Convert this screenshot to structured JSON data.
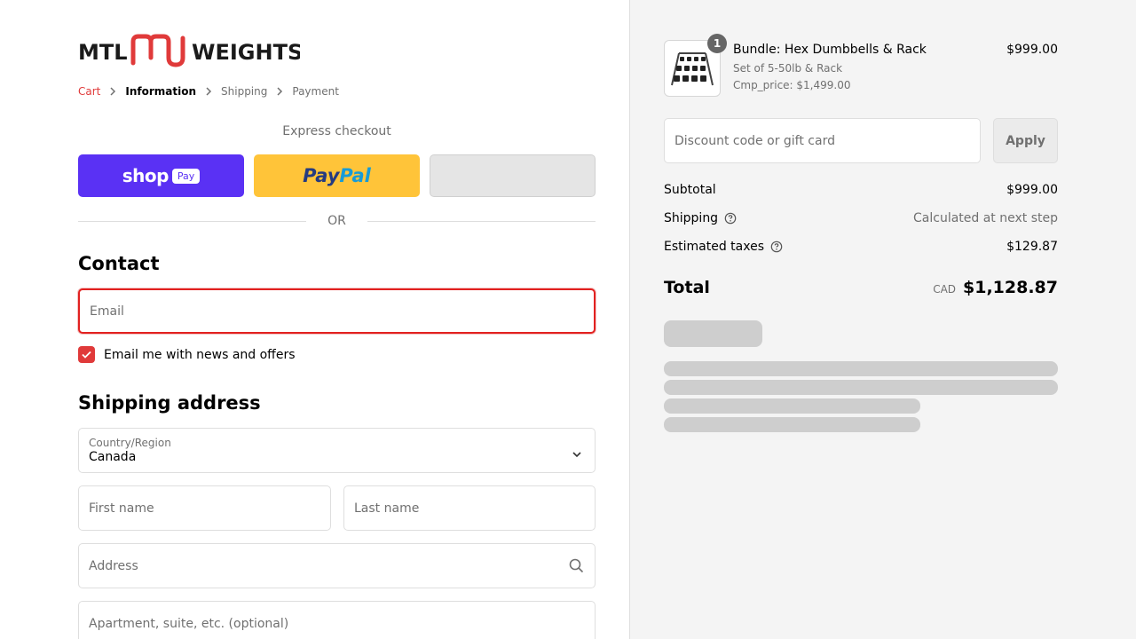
{
  "brand": {
    "logo_left": "MTL",
    "logo_right": "WEIGHTS",
    "accent_color": "#e03a3a"
  },
  "breadcrumb": {
    "items": [
      {
        "label": "Cart",
        "state": "link"
      },
      {
        "label": "Information",
        "state": "active"
      },
      {
        "label": "Shipping",
        "state": "inactive"
      },
      {
        "label": "Payment",
        "state": "inactive"
      }
    ]
  },
  "express": {
    "title": "Express checkout",
    "shop_label": "shop",
    "shop_pay_label": "Pay",
    "paypal_label_1": "Pay",
    "paypal_label_2": "Pal",
    "divider_label": "OR"
  },
  "contact": {
    "heading": "Contact",
    "email_placeholder": "Email",
    "newsletter_label": "Email me with news and offers",
    "newsletter_checked": true
  },
  "shipping": {
    "heading": "Shipping address",
    "country_label": "Country/Region",
    "country_value": "Canada",
    "first_name_placeholder": "First name",
    "last_name_placeholder": "Last name",
    "address_placeholder": "Address",
    "apartment_placeholder": "Apartment, suite, etc. (optional)"
  },
  "summary": {
    "product": {
      "quantity": "1",
      "name": "Bundle: Hex Dumbbells & Rack",
      "variant": "Set of 5-50lb & Rack",
      "compare": "Cmp_price: $1,499.00",
      "price": "$999.00"
    },
    "discount_placeholder": "Discount code or gift card",
    "apply_label": "Apply",
    "subtotal_label": "Subtotal",
    "subtotal_value": "$999.00",
    "shipping_label": "Shipping",
    "shipping_value": "Calculated at next step",
    "taxes_label": "Estimated taxes",
    "taxes_value": "$129.87",
    "total_label": "Total",
    "currency": "CAD",
    "total_value": "$1,128.87"
  }
}
